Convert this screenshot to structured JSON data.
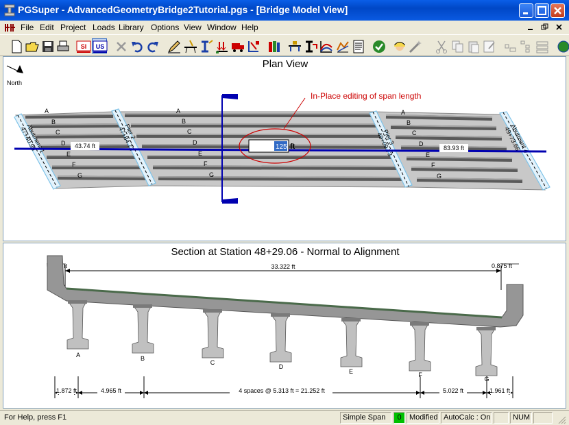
{
  "window": {
    "title": "PGSuper - AdvancedGeometryBridge2Tutorial.pgs - [Bridge Model View]"
  },
  "menu": [
    "File",
    "Edit",
    "Project",
    "Loads",
    "Library",
    "Options",
    "View",
    "Window",
    "Help"
  ],
  "toolbar": {
    "si_label": "SI",
    "us_label": "US"
  },
  "plan": {
    "title": "Plan View",
    "north_label": "North",
    "annotation": "In-Place editing of span length",
    "span_edit_value": "125",
    "span_edit_unit": "ft",
    "span1_length": "43.74 ft",
    "span3_length": "83.93 ft",
    "girders": [
      "A",
      "B",
      "C",
      "D",
      "E",
      "F",
      "G"
    ],
    "pier_labels": [
      "Abutment 1",
      "Pier 2",
      "Pier 3",
      "Abutment 4"
    ],
    "pier_stations": [
      "47+40.99",
      "47+84.73",
      "49+09.73",
      "49+73.66"
    ]
  },
  "section": {
    "title": "Section at Station 48+29.06 - Normal to Alignment",
    "overhang_left": "0.875 ft",
    "overhang_right": "0.875 ft",
    "deck_width": "33.322 ft",
    "girders": [
      "A",
      "B",
      "C",
      "D",
      "E",
      "F",
      "G"
    ],
    "dim_left": "1.872 ft",
    "dim_first": "4.965 ft",
    "dim_spaces": "4 spaces @ 5.313 ft = 21.252 ft",
    "dim_last": "5.022 ft",
    "dim_right": "1.961 ft"
  },
  "status": {
    "help": "For Help, press F1",
    "span_type": "Simple Span",
    "count": "0",
    "modified": "Modified",
    "autocalc": "AutoCalc : On",
    "num": "NUM"
  }
}
